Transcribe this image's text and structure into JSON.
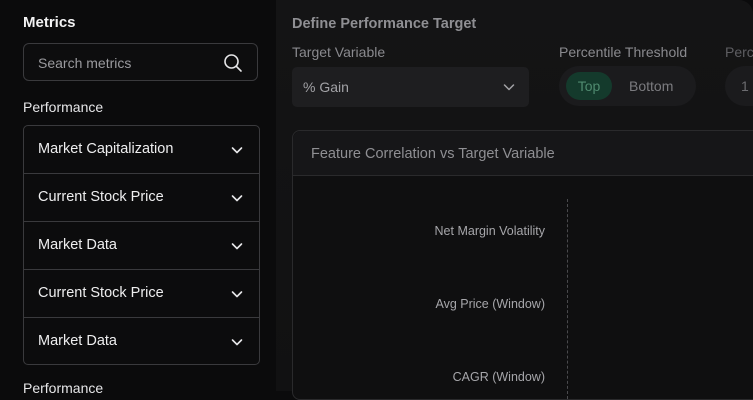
{
  "sidebar": {
    "title": "Metrics",
    "search": {
      "placeholder": "Search metrics",
      "icon": "search-icon"
    },
    "section_1": "Performance",
    "items": [
      {
        "label": "Market Capitalization",
        "icon": "chevron-down-icon"
      },
      {
        "label": "Current Stock Price",
        "icon": "chevron-down-icon"
      },
      {
        "label": "Market Data",
        "icon": "chevron-down-icon"
      },
      {
        "label": "Current Stock Price",
        "icon": "chevron-down-icon"
      },
      {
        "label": "Market Data",
        "icon": "chevron-down-icon"
      }
    ],
    "section_2": "Performance"
  },
  "main": {
    "title": "Define Performance Target",
    "target_variable": {
      "label": "Target Variable",
      "value": "% Gain"
    },
    "percentile_threshold": {
      "label": "Percentile Threshold",
      "options": [
        "Top",
        "Bottom"
      ],
      "selected": "Top"
    },
    "cut_label": "Perc",
    "cut_value": "1",
    "chart_card": {
      "title": "Feature Correlation vs Target Variable"
    }
  },
  "chart_data": {
    "type": "bar",
    "title": "Feature Correlation vs Target Variable",
    "categories": [
      "Net Margin Volatility",
      "Avg Price (Window)",
      "CAGR (Window)"
    ],
    "values": [],
    "xlabel": "",
    "ylabel": "",
    "grid": false
  },
  "colors": {
    "background": "#0b0b0c",
    "toggle_active": "#143a2c",
    "toggle_active_text": "#4f8a6f",
    "border": "#3a3a3d"
  }
}
